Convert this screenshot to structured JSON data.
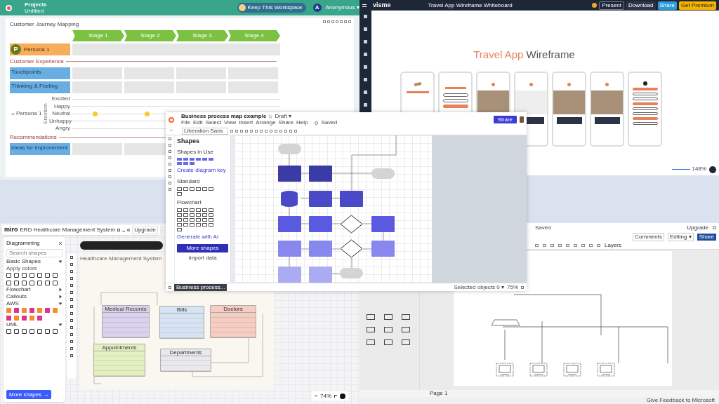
{
  "journey": {
    "header": {
      "section": "Projects",
      "document": "Untitled",
      "keep_button": "Keep This Workspace",
      "avatar": "A",
      "user": "Anonymous ▾"
    },
    "title": "Customer Journey Mapping",
    "stages": [
      "Stage 1",
      "Stage 2",
      "Stage 3",
      "Stage 4"
    ],
    "persona": {
      "initial": "P",
      "name": "Persona 1"
    },
    "experience_label": "Customer Experience",
    "experience_rows": [
      "Touchpoints",
      "Thinking & Feeling"
    ],
    "emotion": {
      "persona": "Persona 1",
      "axis": "Emotion",
      "levels": [
        {
          "label": "Excited",
          "faces": false
        },
        {
          "label": "Happy",
          "faces": false
        },
        {
          "label": "Neutral",
          "faces": true
        },
        {
          "label": "Unhappy",
          "faces": false
        },
        {
          "label": "Angry",
          "faces": false
        }
      ]
    },
    "recommendations_label": "Recommendations",
    "recommendation_rows": [
      "Ideas for Improvement"
    ]
  },
  "wireframe": {
    "header": {
      "logo": "visme",
      "title": "Travel App Wireframe Whiteboard",
      "buttons": [
        {
          "label": "Present",
          "kind": "outline"
        },
        {
          "label": "Download",
          "kind": "dark"
        },
        {
          "label": "Share",
          "kind": "blue"
        },
        {
          "label": "Get Premium",
          "kind": "yellow"
        }
      ]
    },
    "heading": {
      "accent": "Travel App",
      "rest": "Wireframe"
    },
    "phones": [
      {
        "kind": "splash"
      },
      {
        "kind": "login"
      },
      {
        "kind": "screen"
      },
      {
        "kind": "list"
      },
      {
        "kind": "screen"
      },
      {
        "kind": "screen"
      },
      {
        "kind": "profile"
      }
    ],
    "zoom": "148%"
  },
  "process_map": {
    "title": "Business process map example",
    "status": "Draft ▾",
    "menu": [
      "File",
      "Edit",
      "Select",
      "View",
      "Insert",
      "Arrange",
      "Share",
      "Help"
    ],
    "saved": "Saved",
    "font": "Liberation Sans",
    "share_button": "Share",
    "panel": {
      "title": "Shapes",
      "in_use": "Shapes in Use",
      "diagram_key": "Create diagram key",
      "standard": "Standard",
      "flowchart": "Flowchart",
      "generate": "Generate with AI",
      "more_shapes": "More shapes",
      "import": "Import data"
    },
    "nodes": [
      {
        "kind": "terminal",
        "color": "#d4d4d4"
      },
      {
        "kind": "process",
        "color": "#3b3ba6"
      },
      {
        "kind": "process",
        "color": "#3b3ba6"
      },
      {
        "kind": "terminal",
        "color": "#d4d4d4"
      },
      {
        "kind": "data",
        "color": "#4a4ac8"
      },
      {
        "kind": "process",
        "color": "#4a4ac8"
      },
      {
        "kind": "process",
        "color": "#4a4ac8"
      },
      {
        "kind": "process",
        "color": "#5a5ae0"
      },
      {
        "kind": "process",
        "color": "#5a5ae0"
      },
      {
        "kind": "decision",
        "color": "#ffffff"
      },
      {
        "kind": "process",
        "color": "#5a5ae0"
      },
      {
        "kind": "process",
        "color": "#8787ee"
      },
      {
        "kind": "process",
        "color": "#8787ee"
      },
      {
        "kind": "decision",
        "color": "#ffffff"
      },
      {
        "kind": "process",
        "color": "#8787ee"
      },
      {
        "kind": "process",
        "color": "#ababf3"
      },
      {
        "kind": "process",
        "color": "#ababf3"
      },
      {
        "kind": "terminal",
        "color": "#d4d4d4"
      }
    ],
    "page_tab": "Business process...",
    "selection": "Selected objects 0 ▾",
    "zoom": "75%"
  },
  "erd": {
    "header": {
      "logo": "miro",
      "title": "ERD Healthcare Management System",
      "upgrade": "Upgrade"
    },
    "panel": {
      "title": "Diagramming",
      "search_placeholder": "Search shapes",
      "sections": [
        {
          "label": "Basic Shapes",
          "expanded": true
        },
        {
          "label": "Flowchart",
          "expanded": false
        },
        {
          "label": "Callouts",
          "expanded": false
        },
        {
          "label": "AWS",
          "expanded": true
        },
        {
          "label": "UML",
          "expanded": true
        }
      ],
      "apply_colors": "Apply colors",
      "more_shapes": "More shapes →"
    },
    "frame_title": "Healthcare Management System",
    "tables": [
      {
        "name": "Medical Records",
        "color": "#d9d2ec"
      },
      {
        "name": "Bills",
        "color": "#d6e3f3"
      },
      {
        "name": "Doctors",
        "color": "#f6cdc2"
      },
      {
        "name": "Appointments",
        "color": "#e3f1c0"
      },
      {
        "name": "Departments",
        "color": "#e9e9ec"
      }
    ],
    "zoom": "74%"
  },
  "network": {
    "saved": "Saved",
    "upgrade": "Upgrade",
    "comments": "Comments",
    "editing": "Editing ▾",
    "share": "Share",
    "layers": "Layers",
    "page_tab": "Page 1",
    "feedback": "Give Feedback to Microsoft"
  }
}
